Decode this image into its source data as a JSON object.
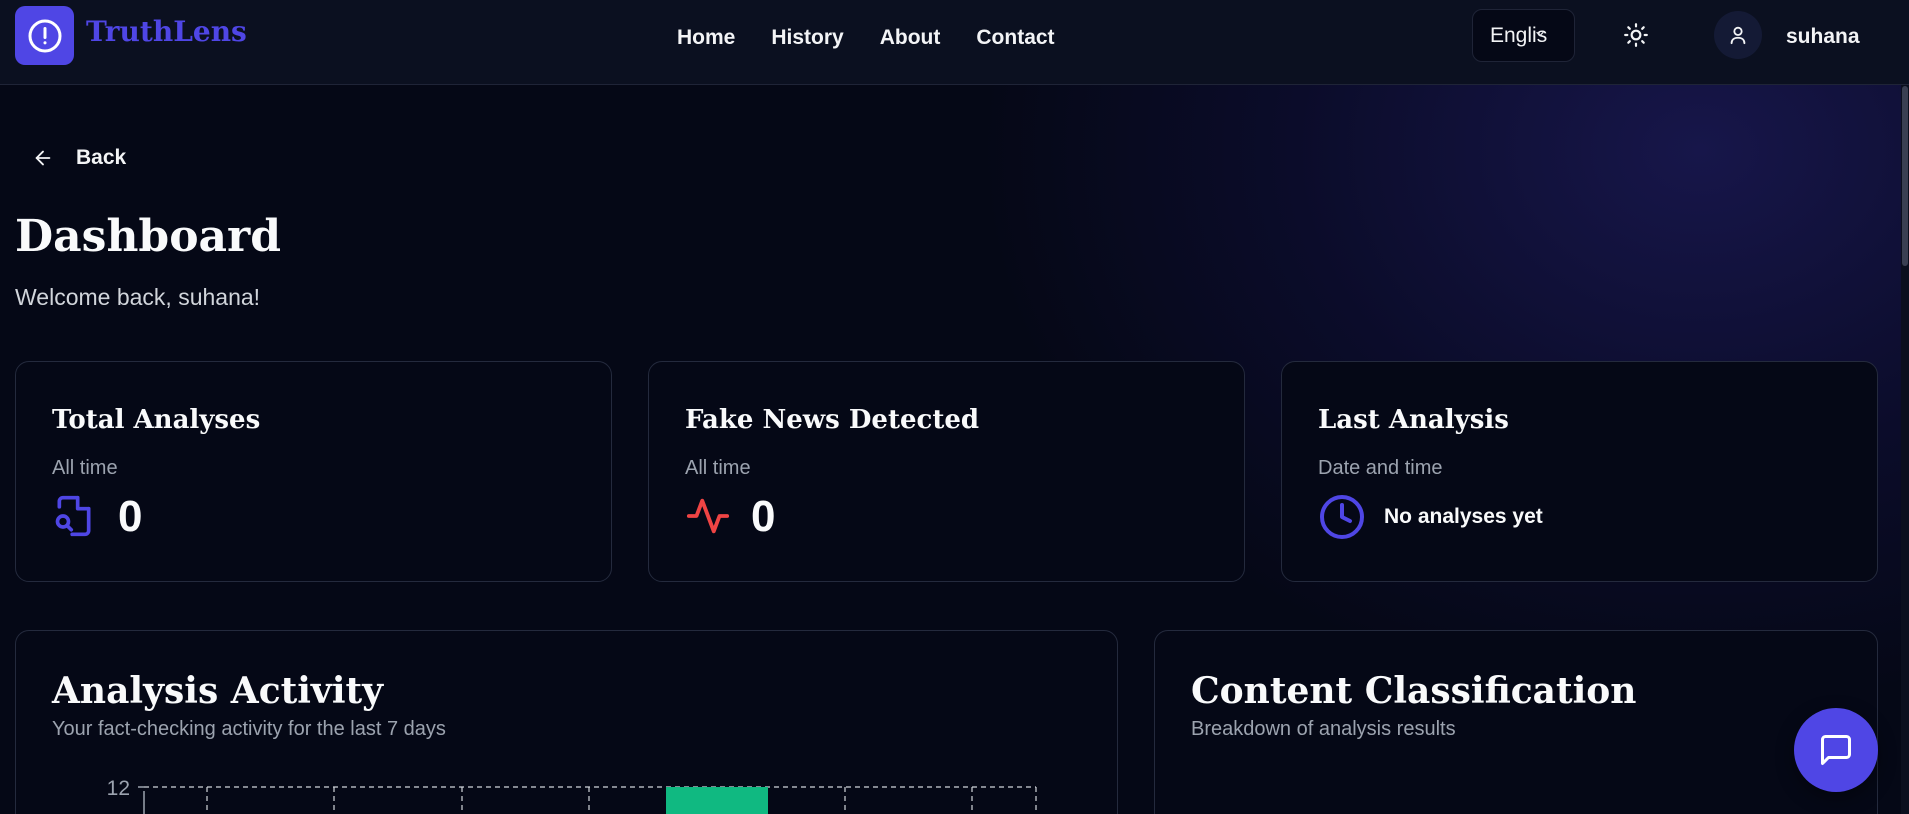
{
  "app": {
    "name": "TruthLens",
    "brand_color": "#4f46e5"
  },
  "nav": {
    "links": [
      "Home",
      "History",
      "About",
      "Contact"
    ],
    "language": "English",
    "user": "suhana"
  },
  "page": {
    "back_label": "Back",
    "title": "Dashboard",
    "welcome": "Welcome back, suhana!"
  },
  "stats": [
    {
      "title": "Total Analyses",
      "subtitle": "All time",
      "value": "0",
      "icon": "file-search-icon"
    },
    {
      "title": "Fake News Detected",
      "subtitle": "All time",
      "value": "0",
      "icon": "activity-icon"
    },
    {
      "title": "Last Analysis",
      "subtitle": "Date and time",
      "value": "No analyses yet",
      "icon": "clock-icon"
    }
  ],
  "activity": {
    "title": "Analysis Activity",
    "subtitle": "Your fact-checking activity for the last 7 days"
  },
  "classification": {
    "title": "Content Classification",
    "subtitle": "Breakdown of analysis results"
  },
  "chart_data": {
    "type": "bar",
    "title": "Analysis Activity",
    "visible_ticks": [
      12
    ],
    "bar_color": "#10b981",
    "grid": true,
    "note_values": [
      12
    ]
  }
}
